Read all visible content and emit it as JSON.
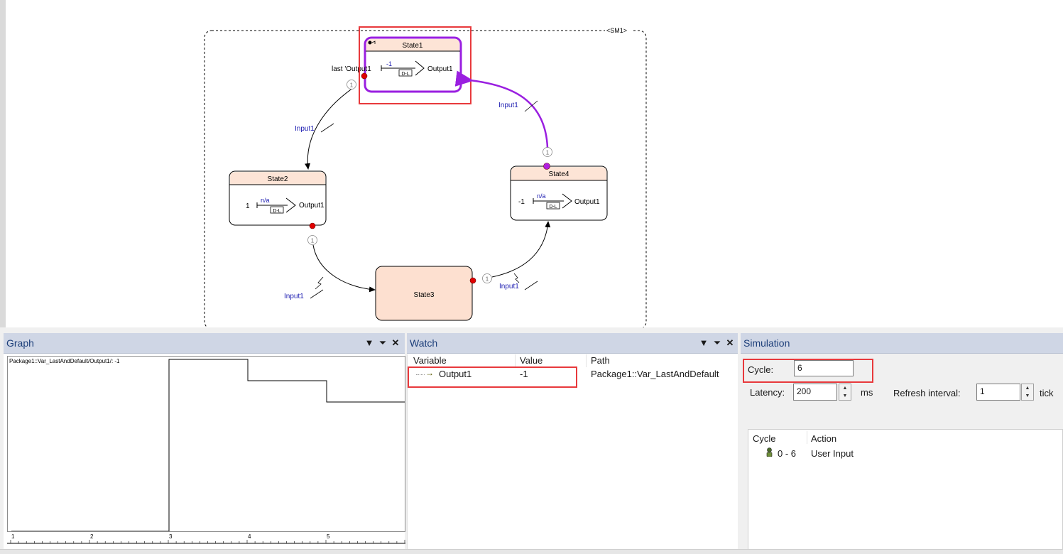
{
  "diagram": {
    "state_machine_label": "<SM1>",
    "states": {
      "state1": {
        "name": "State1",
        "input_label": "last 'Output1",
        "edge_label": "-1",
        "delay_tag": "D-L",
        "output": "Output1"
      },
      "state2": {
        "name": "State2",
        "input_label": "1",
        "edge_label": "n/a",
        "delay_tag": "D-L",
        "output": "Output1"
      },
      "state3": {
        "name": "State3"
      },
      "state4": {
        "name": "State4",
        "input_label": "-1",
        "edge_label": "n/a",
        "delay_tag": "D-L",
        "output": "Output1"
      }
    },
    "transitions": [
      {
        "id": "t12",
        "label": "Input1",
        "priority": "1"
      },
      {
        "id": "t23",
        "label": "Input1",
        "priority": "1"
      },
      {
        "id": "t34",
        "label": "Input1",
        "priority": "1"
      },
      {
        "id": "t41",
        "label": "Input1",
        "priority": "1"
      }
    ],
    "colors": {
      "state_header": "#fde4d6",
      "state3_fill": "#fde0d0",
      "active": "#9a1fe0",
      "highlight": "#e8393c",
      "transition_label": "#1a1ab0",
      "connector": "#e00000"
    }
  },
  "graph": {
    "title": "Graph",
    "series_label": "Package1::Var_LastAndDefault/Output1/: -1",
    "x_ticks": [
      "1",
      "2",
      "3",
      "4",
      "5"
    ],
    "chart_data": {
      "type": "line",
      "series": [
        {
          "x": [
            1,
            2,
            3,
            3,
            4,
            4,
            5,
            5,
            6
          ],
          "y": [
            -1,
            -1,
            -1,
            1,
            1,
            0,
            0,
            -1,
            -1
          ]
        }
      ]
    }
  },
  "watch": {
    "title": "Watch",
    "columns": {
      "variable": "Variable",
      "value": "Value",
      "path": "Path"
    },
    "rows": [
      {
        "variable": "Output1",
        "value": "-1",
        "path": "Package1::Var_LastAndDefault"
      }
    ]
  },
  "simulation": {
    "title": "Simulation",
    "cycle_label": "Cycle:",
    "cycle_value": "6",
    "latency_label": "Latency:",
    "latency_value": "200",
    "latency_unit": "ms",
    "refresh_label": "Refresh interval:",
    "refresh_value": "1",
    "refresh_unit": "tick",
    "list_columns": {
      "cycle": "Cycle",
      "action": "Action"
    },
    "list_rows": [
      {
        "cycle": "0 - 6",
        "action": "User Input"
      }
    ]
  },
  "icons": {
    "dropdown": "chevron-down-icon",
    "pin": "pin-icon",
    "close": "close-icon"
  }
}
